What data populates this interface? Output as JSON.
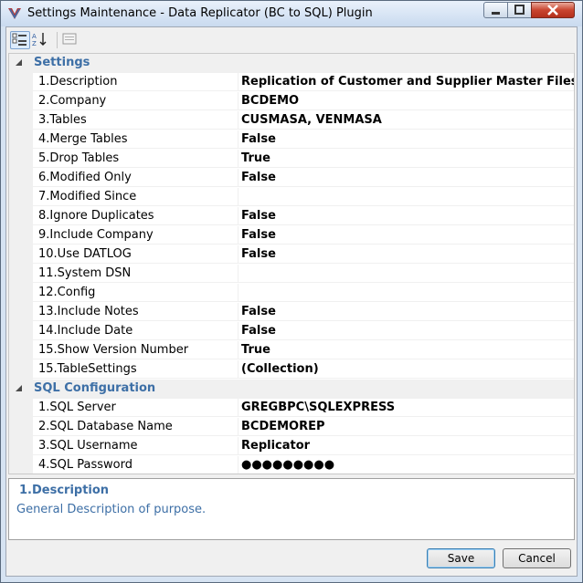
{
  "window": {
    "title": "Settings Maintenance - Data Replicator (BC to SQL) Plugin",
    "controls": {
      "minimize": "minimize-icon",
      "maximize": "maximize-icon",
      "close": "close-icon"
    }
  },
  "toolbar": {
    "buttons": [
      {
        "icon": "categorized-icon",
        "active": true
      },
      {
        "icon": "alphabetical-sort-icon",
        "active": false
      },
      {
        "icon": "property-pages-icon",
        "active": false
      }
    ]
  },
  "categories": [
    {
      "label": "Settings",
      "rows": [
        {
          "name": "1.Description",
          "value": "Replication of Customer and Supplier Master Files"
        },
        {
          "name": "2.Company",
          "value": "BCDEMO"
        },
        {
          "name": "3.Tables",
          "value": "CUSMASA, VENMASA"
        },
        {
          "name": "4.Merge Tables",
          "value": "False"
        },
        {
          "name": "5.Drop Tables",
          "value": "True"
        },
        {
          "name": "6.Modified Only",
          "value": "False"
        },
        {
          "name": "7.Modified Since",
          "value": ""
        },
        {
          "name": "8.Ignore Duplicates",
          "value": "False"
        },
        {
          "name": "9.Include Company",
          "value": "False"
        },
        {
          "name": "10.Use DATLOG",
          "value": "False"
        },
        {
          "name": "11.System DSN",
          "value": ""
        },
        {
          "name": "12.Config",
          "value": ""
        },
        {
          "name": "13.Include Notes",
          "value": "False"
        },
        {
          "name": "14.Include Date",
          "value": "False"
        },
        {
          "name": "15.Show Version Number",
          "value": "True"
        },
        {
          "name": "15.TableSettings",
          "value": "(Collection)"
        }
      ]
    },
    {
      "label": "SQL Configuration",
      "rows": [
        {
          "name": "1.SQL Server",
          "value": "GREGBPC\\SQLEXPRESS"
        },
        {
          "name": "2.SQL Database Name",
          "value": "BCDEMOREP"
        },
        {
          "name": "3.SQL Username",
          "value": "Replicator"
        },
        {
          "name": "4.SQL Password",
          "value": "●●●●●●●●●"
        }
      ]
    }
  ],
  "description": {
    "title": "1.Description",
    "text": "General Description of purpose."
  },
  "buttons": {
    "save": "Save",
    "cancel": "Cancel"
  },
  "colors": {
    "category_text": "#3d6fa6",
    "close_button": "#c9452f"
  }
}
